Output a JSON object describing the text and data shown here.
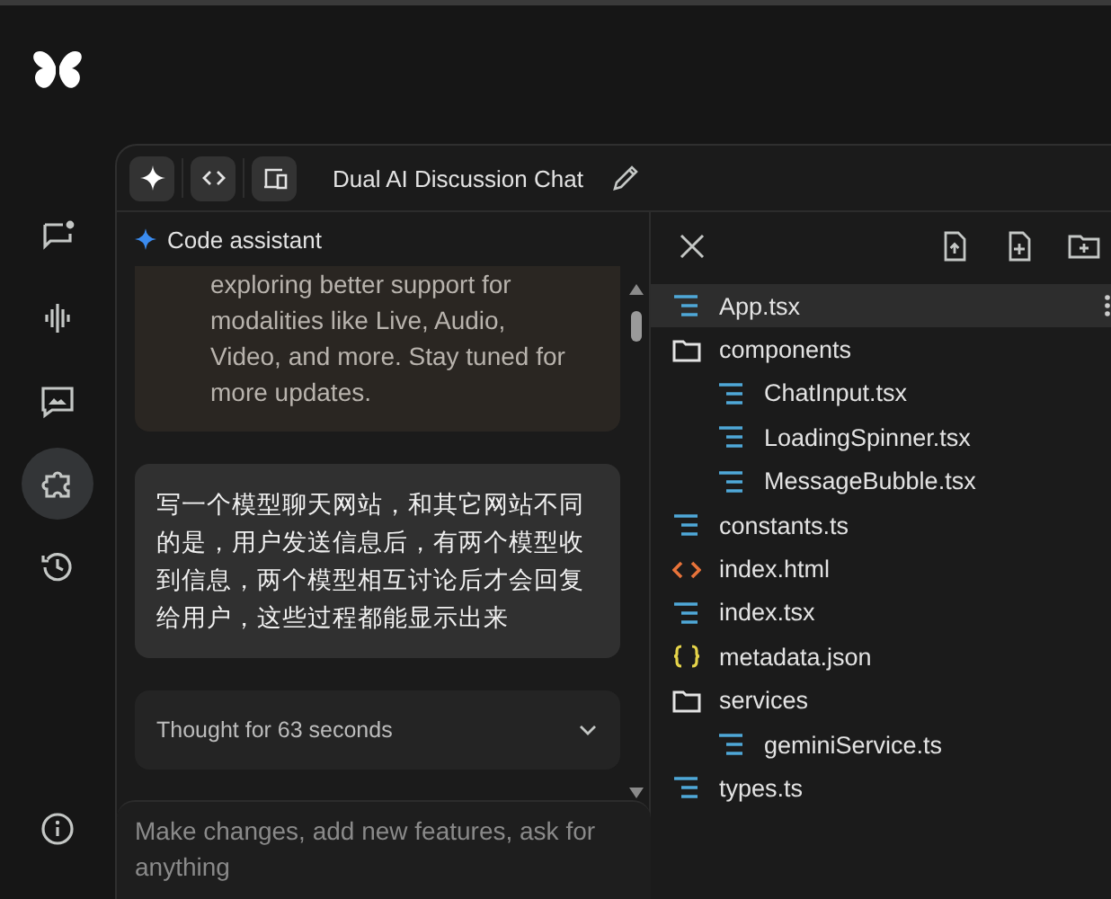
{
  "rail": {
    "items": [
      {
        "selected": false
      },
      {
        "selected": false
      },
      {
        "selected": false
      },
      {
        "selected": true
      },
      {
        "selected": false
      }
    ],
    "bottom": {
      "selected": false
    }
  },
  "toolbar": {
    "title": "Dual AI Discussion Chat"
  },
  "chat": {
    "header": "Code assistant",
    "messages": [
      {
        "kind": "assistant",
        "text": "exploring better support for modalities like Live, Audio, Video, and more. Stay tuned for more updates."
      },
      {
        "kind": "user",
        "text": "写一个模型聊天网站，和其它网站不同的是，用户发送信息后，有两个模型收到信息，两个模型相互讨论后才会回复给用户，这些过程都能显示出来"
      },
      {
        "kind": "thought",
        "text": "Thought for 63 seconds",
        "expanded": false
      }
    ],
    "input": {
      "placeholder": "Make changes, add new features, ask for anything"
    }
  },
  "files": [
    {
      "name": "App.tsx",
      "kind": "ts",
      "selected": true
    },
    {
      "name": "components",
      "kind": "folder",
      "selected": false,
      "children": [
        {
          "name": "ChatInput.tsx",
          "kind": "ts",
          "selected": false
        },
        {
          "name": "LoadingSpinner.tsx",
          "kind": "ts",
          "selected": false
        },
        {
          "name": "MessageBubble.tsx",
          "kind": "ts",
          "selected": false
        }
      ]
    },
    {
      "name": "constants.ts",
      "kind": "ts",
      "selected": false
    },
    {
      "name": "index.html",
      "kind": "html",
      "selected": false
    },
    {
      "name": "index.tsx",
      "kind": "ts",
      "selected": false
    },
    {
      "name": "metadata.json",
      "kind": "json",
      "selected": false
    },
    {
      "name": "services",
      "kind": "folder",
      "selected": false,
      "children": [
        {
          "name": "geminiService.ts",
          "kind": "ts",
          "selected": false
        }
      ]
    },
    {
      "name": "types.ts",
      "kind": "ts",
      "selected": false
    }
  ]
}
